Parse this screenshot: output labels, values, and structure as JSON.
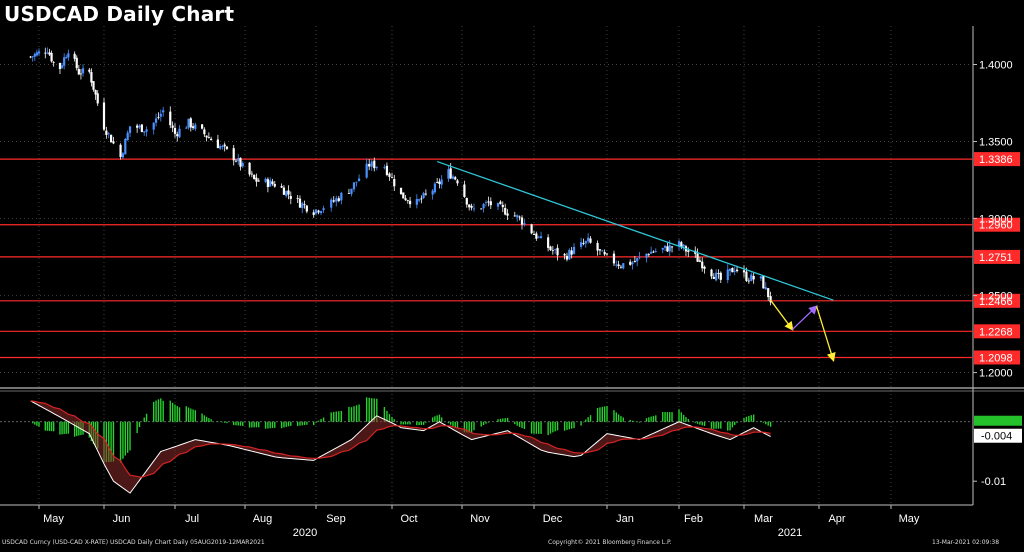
{
  "chart_data": [
    {
      "type": "candlestick",
      "title": "USDCAD Daily Chart",
      "x_months": [
        "May",
        "Jun",
        "Jul",
        "Aug",
        "Sep",
        "Oct",
        "Nov",
        "Dec",
        "Jan",
        "Feb",
        "Mar",
        "Apr",
        "May"
      ],
      "x_years": [
        "2020",
        "2021"
      ],
      "y_ticks": [
        1.4,
        1.35,
        1.3,
        1.25,
        1.2
      ],
      "y_tick_labels": [
        "1.4000",
        "1.3500",
        "1.3000",
        "1.2500",
        "1.2000"
      ],
      "ylim": [
        1.19,
        1.425
      ],
      "grid": true,
      "price_path": [
        [
          "2020-04-27",
          1.405
        ],
        [
          "2020-05-05",
          1.41
        ],
        [
          "2020-05-10",
          1.395
        ],
        [
          "2020-05-15",
          1.41
        ],
        [
          "2020-05-20",
          1.395
        ],
        [
          "2020-05-25",
          1.395
        ],
        [
          "2020-06-01",
          1.36
        ],
        [
          "2020-06-08",
          1.34
        ],
        [
          "2020-06-12",
          1.36
        ],
        [
          "2020-06-20",
          1.358
        ],
        [
          "2020-06-26",
          1.37
        ],
        [
          "2020-07-01",
          1.355
        ],
        [
          "2020-07-07",
          1.362
        ],
        [
          "2020-07-13",
          1.356
        ],
        [
          "2020-07-20",
          1.348
        ],
        [
          "2020-07-27",
          1.34
        ],
        [
          "2020-08-05",
          1.325
        ],
        [
          "2020-08-15",
          1.322
        ],
        [
          "2020-08-25",
          1.31
        ],
        [
          "2020-08-31",
          1.305
        ],
        [
          "2020-09-07",
          1.31
        ],
        [
          "2020-09-15",
          1.32
        ],
        [
          "2020-09-22",
          1.335
        ],
        [
          "2020-09-28",
          1.334
        ],
        [
          "2020-10-05",
          1.315
        ],
        [
          "2020-10-12",
          1.31
        ],
        [
          "2020-10-20",
          1.32
        ],
        [
          "2020-10-26",
          1.33
        ],
        [
          "2020-10-30",
          1.325
        ],
        [
          "2020-11-05",
          1.305
        ],
        [
          "2020-11-12",
          1.31
        ],
        [
          "2020-11-19",
          1.305
        ],
        [
          "2020-11-25",
          1.3
        ],
        [
          "2020-12-01",
          1.29
        ],
        [
          "2020-12-08",
          1.28
        ],
        [
          "2020-12-14",
          1.275
        ],
        [
          "2020-12-18",
          1.28
        ],
        [
          "2020-12-24",
          1.285
        ],
        [
          "2020-12-31",
          1.275
        ],
        [
          "2021-01-07",
          1.27
        ],
        [
          "2021-01-13",
          1.272
        ],
        [
          "2021-01-19",
          1.278
        ],
        [
          "2021-01-25",
          1.28
        ],
        [
          "2021-02-01",
          1.283
        ],
        [
          "2021-02-08",
          1.275
        ],
        [
          "2021-02-15",
          1.265
        ],
        [
          "2021-02-19",
          1.26
        ],
        [
          "2021-02-25",
          1.268
        ],
        [
          "2021-03-02",
          1.262
        ],
        [
          "2021-03-08",
          1.26
        ],
        [
          "2021-03-12",
          1.247
        ]
      ],
      "levels": [
        {
          "value": 1.3386,
          "label": "1.3386"
        },
        {
          "value": 1.296,
          "label": "1.2960"
        },
        {
          "value": 1.2751,
          "label": "1.2751"
        },
        {
          "value": 1.2466,
          "label": "1.2466"
        },
        {
          "value": 1.2268,
          "label": "1.2268"
        },
        {
          "value": 1.2098,
          "label": "1.2098"
        }
      ],
      "trendline": [
        [
          "2020-10-21",
          1.337
        ],
        [
          "2021-04-07",
          1.247
        ]
      ],
      "projection": [
        {
          "from": [
            "2021-03-12",
            1.247
          ],
          "to": [
            "2021-03-21",
            1.228
          ],
          "color": "#ffee33"
        },
        {
          "from": [
            "2021-03-21",
            1.228
          ],
          "to": [
            "2021-03-31",
            1.243
          ],
          "color": "#a06bff"
        },
        {
          "from": [
            "2021-03-31",
            1.243
          ],
          "to": [
            "2021-04-07",
            1.208
          ],
          "color": "#ffee33"
        }
      ]
    },
    {
      "type": "macd",
      "y_ticks": [
        0,
        -0.01
      ],
      "y_tick_labels": [
        "0",
        "-0.01"
      ],
      "current_value_label": "-0.004",
      "ylim": [
        -0.014,
        0.005
      ],
      "macd_path": [
        [
          "2020-04-27",
          0.0035
        ],
        [
          "2020-05-10",
          0.001
        ],
        [
          "2020-05-25",
          -0.002
        ],
        [
          "2020-06-05",
          -0.01
        ],
        [
          "2020-06-12",
          -0.012
        ],
        [
          "2020-06-25",
          -0.005
        ],
        [
          "2020-07-10",
          -0.003
        ],
        [
          "2020-07-25",
          -0.004
        ],
        [
          "2020-08-15",
          -0.006
        ],
        [
          "2020-08-31",
          -0.0065
        ],
        [
          "2020-09-15",
          -0.003
        ],
        [
          "2020-09-25",
          0.001
        ],
        [
          "2020-10-05",
          -0.001
        ],
        [
          "2020-10-15",
          -0.0015
        ],
        [
          "2020-10-22",
          0.0
        ],
        [
          "2020-11-05",
          -0.003
        ],
        [
          "2020-11-20",
          -0.0015
        ],
        [
          "2020-12-05",
          -0.005
        ],
        [
          "2020-12-20",
          -0.006
        ],
        [
          "2021-01-01",
          -0.002
        ],
        [
          "2021-01-15",
          -0.003
        ],
        [
          "2021-02-01",
          0.0
        ],
        [
          "2021-02-15",
          -0.002
        ],
        [
          "2021-02-23",
          -0.003
        ],
        [
          "2021-03-05",
          -0.001
        ],
        [
          "2021-03-12",
          -0.0025
        ]
      ]
    }
  ],
  "footer": {
    "left": "USDCAD Curncy (USD-CAD X-RATE) USDCAD Daily Chart  Daily 05AUG2019-12MAR2021",
    "center": "Copyright© 2021 Bloomberg Finance L.P.",
    "right": "13-Mar-2021 02:09:38"
  },
  "colors": {
    "background": "#000000",
    "up_candle": "#4a90ff",
    "down_candle": "#ffffff",
    "support_line": "#ff2a2a",
    "level_label_bg": "#ff2a2a",
    "trendline": "#2fc6d8",
    "histogram_positive": "#27d12f",
    "macd_line": "#ffffff",
    "signal_line": "#d62222"
  }
}
